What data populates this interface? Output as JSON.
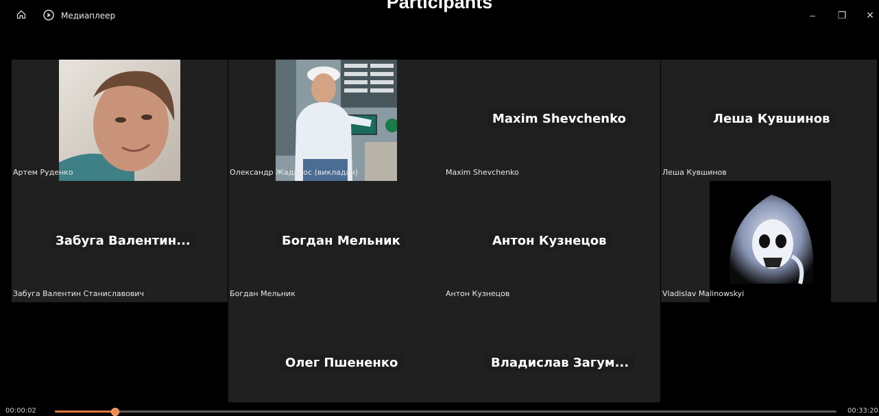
{
  "overlay": {
    "title": "Participants"
  },
  "window": {
    "title": "Медиаплеер",
    "controls": {
      "minimize": "–",
      "restore": "❐",
      "close": "✕"
    }
  },
  "tiles": {
    "t1": {
      "caption": "Артем Руденко"
    },
    "t2": {
      "caption": "Олександр Жаданос (викладач)"
    },
    "t3": {
      "name": "Maxim Shevchenko",
      "caption": "Maxim Shevchenko"
    },
    "t4": {
      "name": "Леша Кувшинов",
      "caption": "Леша Кувшинов"
    },
    "t5": {
      "name": "Забуга  Валентин...",
      "caption": "Забуга Валентин Станиславович"
    },
    "t6": {
      "name": "Богдан Мельник",
      "caption": "Богдан Мельник"
    },
    "t7": {
      "name": "Антон Кузнецов",
      "caption": "Антон Кузнецов"
    },
    "t8": {
      "caption": "Vladislav Malinowskyi"
    },
    "t9": {
      "name": "Олег Пшененко"
    },
    "t10": {
      "name": "Владислав  Загум..."
    }
  },
  "player": {
    "current_time": "00:00:02",
    "total_time": "00:33:20",
    "progress_fraction": 0.076,
    "accent_color": "#e2773d"
  }
}
